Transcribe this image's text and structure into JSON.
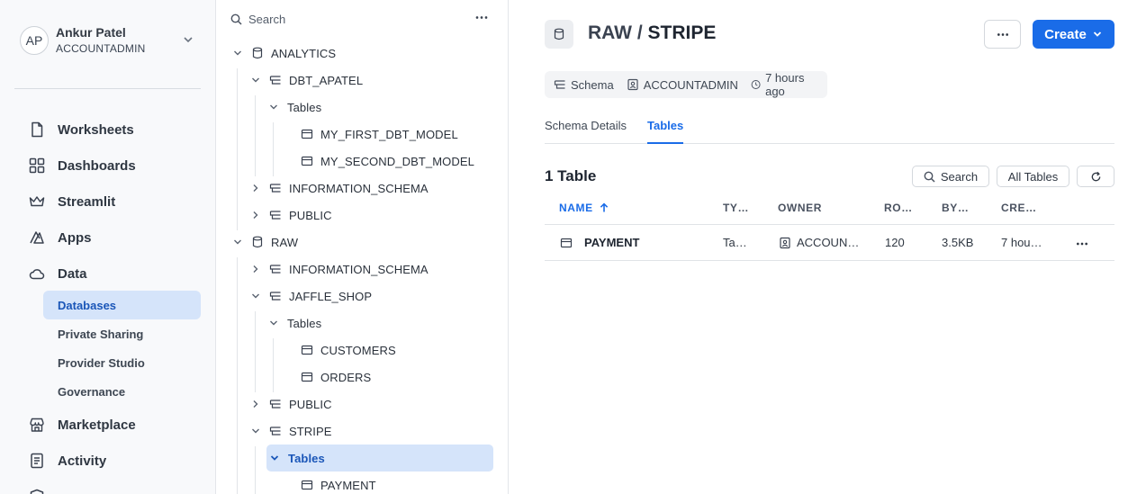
{
  "user": {
    "initials": "AP",
    "name": "Ankur Patel",
    "role": "ACCOUNTADMIN"
  },
  "nav": {
    "worksheets": "Worksheets",
    "dashboards": "Dashboards",
    "streamlit": "Streamlit",
    "apps": "Apps",
    "data": "Data",
    "data_sub": [
      "Databases",
      "Private Sharing",
      "Provider Studio",
      "Governance"
    ],
    "marketplace": "Marketplace",
    "activity": "Activity"
  },
  "tree": {
    "search_placeholder": "Search",
    "rows": [
      "ANALYTICS",
      "DBT_APATEL",
      "Tables",
      "MY_FIRST_DBT_MODEL",
      "MY_SECOND_DBT_MODEL",
      "INFORMATION_SCHEMA",
      "PUBLIC",
      "RAW",
      "INFORMATION_SCHEMA",
      "JAFFLE_SHOP",
      "Tables",
      "CUSTOMERS",
      "ORDERS",
      "PUBLIC",
      "STRIPE",
      "Tables",
      "PAYMENT"
    ]
  },
  "main": {
    "title_prefix": "RAW / ",
    "title_main": "STRIPE",
    "create_label": "Create",
    "meta": {
      "type": "Schema",
      "owner": "ACCOUNTADMIN",
      "time": "7 hours ago"
    },
    "tabs": [
      "Schema Details",
      "Tables"
    ],
    "count_title": "1 Table",
    "search_label": "Search",
    "filter_label": "All Tables",
    "columns": [
      "NAME",
      "TY…",
      "OWNER",
      "RO…",
      "BY…",
      "CRE…"
    ],
    "rows": [
      {
        "name": "PAYMENT",
        "type": "Ta…",
        "owner": "ACCOUN…",
        "rows": "120",
        "bytes": "3.5KB",
        "created": "7 hou…"
      }
    ]
  },
  "colors": {
    "accent": "#1a6ce8",
    "selection": "#d5e4fa",
    "sidebar_bg": "#f8f9fb"
  }
}
